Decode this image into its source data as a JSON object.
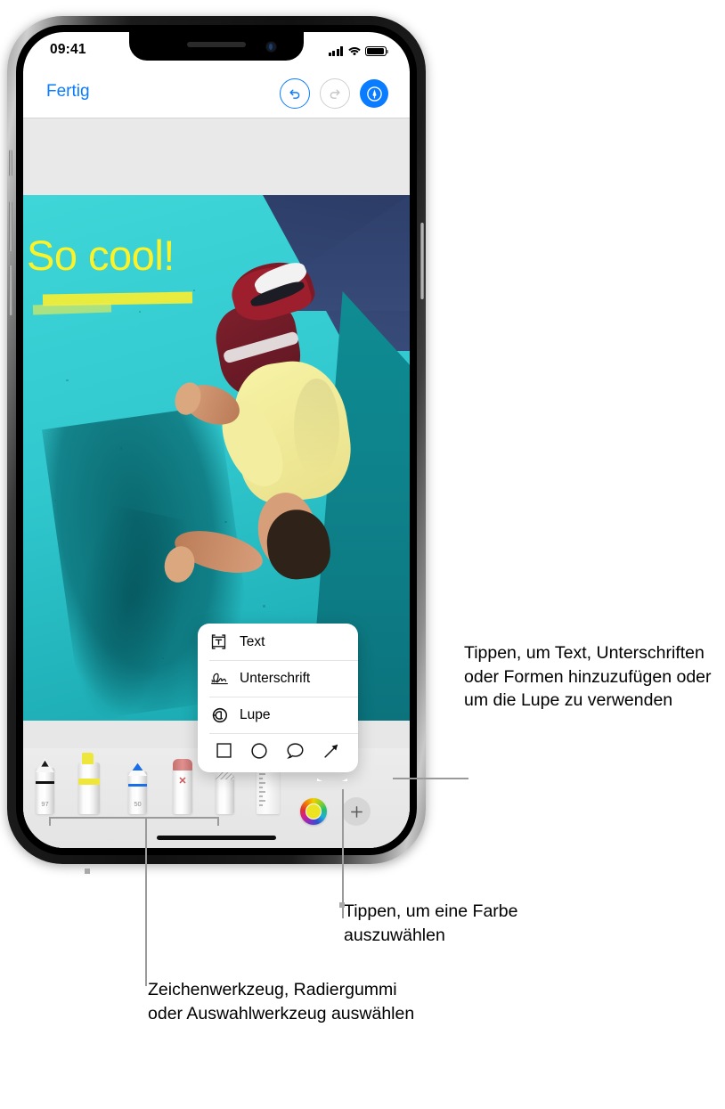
{
  "status_bar": {
    "time": "09:41",
    "signal_icon": "cellular-signal-icon",
    "wifi_icon": "wifi-icon",
    "battery_icon": "battery-icon"
  },
  "nav_bar": {
    "done_label": "Fertig",
    "undo_icon": "undo-arrow-icon",
    "redo_icon": "redo-arrow-icon",
    "markup_icon": "markup-pen-icon",
    "accent_color": "#0a7cff",
    "disabled_color": "#cfcfcf"
  },
  "photo": {
    "annotation_text": "So cool!",
    "annotation_color": "#fbf22a",
    "highlight_color": "#f6ee32",
    "wall_color": "#31c9cf",
    "ceiling_color": "#2e3f6b",
    "right_wall_color": "#0d7b84"
  },
  "popup_menu": {
    "items": [
      {
        "label": "Text",
        "icon": "text-box-icon"
      },
      {
        "label": "Unterschrift",
        "icon": "signature-icon"
      },
      {
        "label": "Lupe",
        "icon": "magnifier-icon"
      }
    ],
    "shapes": [
      {
        "name": "square-shape-icon"
      },
      {
        "name": "circle-shape-icon"
      },
      {
        "name": "speech-bubble-shape-icon"
      },
      {
        "name": "arrow-shape-icon"
      }
    ]
  },
  "toolbar": {
    "tools": [
      {
        "name": "pen-tool",
        "label": "97",
        "tip_color": "#1b1b1b",
        "band_color": "#111111"
      },
      {
        "name": "highlighter-tool",
        "label": "",
        "tip_color": "#eee63a",
        "band_color": "#eee63a"
      },
      {
        "name": "marker-tool",
        "label": "50",
        "tip_color": "#1a6fe8",
        "band_color": "#1a6fe8"
      },
      {
        "name": "eraser-tool",
        "label": "",
        "tip_color": "#d4817f",
        "band_color": "#d4817f"
      },
      {
        "name": "lasso-select-tool",
        "label": "",
        "tip_color": "#b8b8b8",
        "band_color": "#b8b8b8"
      },
      {
        "name": "ruler-tool",
        "label": "",
        "tip_color": "#e0e0e0",
        "band_color": "#e0e0e0"
      }
    ],
    "eraser_mark": "✕",
    "color_picker_name": "color-wheel-button",
    "color_picker_selected": "#ece420",
    "add_button_glyph": "+"
  },
  "callouts": {
    "add": "Tippen, um Text, Unterschriften oder Formen hinzuzufügen oder um die Lupe zu verwenden",
    "color": "Tippen, um eine Farbe auszuwählen",
    "tools": "Zeichenwerkzeug, Radiergummi oder Auswahlwerkzeug auswählen"
  }
}
